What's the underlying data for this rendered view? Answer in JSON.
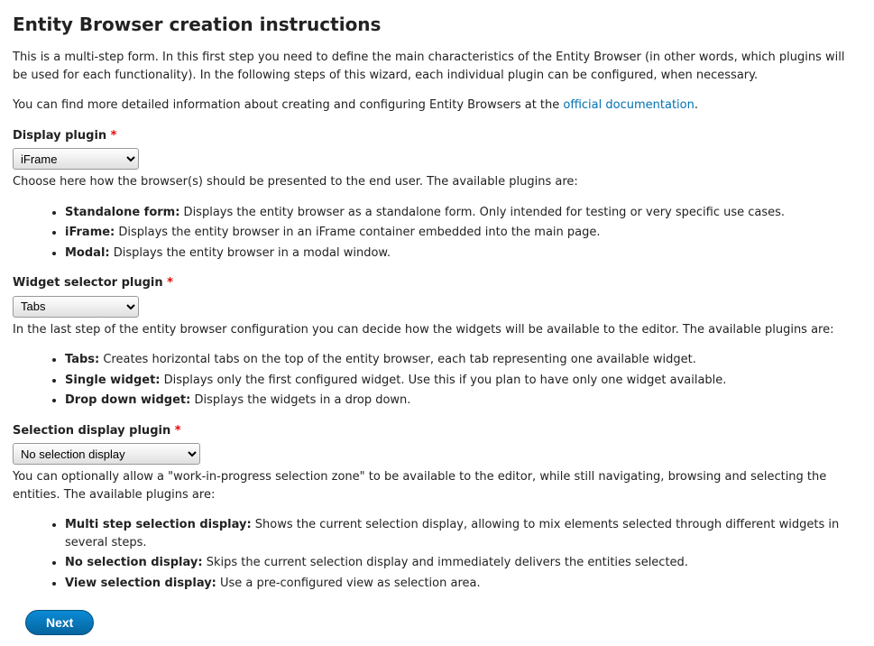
{
  "title": "Entity Browser creation instructions",
  "intro1": "This is a multi-step form. In this first step you need to define the main characteristics of the Entity Browser (in other words, which plugins will be used for each functionality). In the following steps of this wizard, each individual plugin can be configured, when necessary.",
  "intro2_pre": "You can find more detailed information about creating and configuring Entity Browsers at the ",
  "intro2_link": "official documentation",
  "intro2_post": ".",
  "fields": {
    "display": {
      "label": "Display plugin",
      "value": "iFrame",
      "desc": "Choose here how the browser(s) should be presented to the end user. The available plugins are:",
      "options": [
        {
          "name": "Standalone form:",
          "text": " Displays the entity browser as a standalone form. Only intended for testing or very specific use cases."
        },
        {
          "name": "iFrame:",
          "text": " Displays the entity browser in an iFrame container embedded into the main page."
        },
        {
          "name": "Modal:",
          "text": " Displays the entity browser in a modal window."
        }
      ]
    },
    "widget": {
      "label": "Widget selector plugin",
      "value": "Tabs",
      "desc": "In the last step of the entity browser configuration you can decide how the widgets will be available to the editor. The available plugins are:",
      "options": [
        {
          "name": "Tabs:",
          "text": " Creates horizontal tabs on the top of the entity browser, each tab representing one available widget."
        },
        {
          "name": "Single widget:",
          "text": " Displays only the first configured widget. Use this if you plan to have only one widget available."
        },
        {
          "name": "Drop down widget:",
          "text": " Displays the widgets in a drop down."
        }
      ]
    },
    "selection": {
      "label": "Selection display plugin",
      "value": "No selection display",
      "desc": "You can optionally allow a \"work-in-progress selection zone\" to be available to the editor, while still navigating, browsing and selecting the entities. The available plugins are:",
      "options": [
        {
          "name": "Multi step selection display:",
          "text": " Shows the current selection display, allowing to mix elements selected through different widgets in several steps."
        },
        {
          "name": "No selection display:",
          "text": " Skips the current selection display and immediately delivers the entities selected."
        },
        {
          "name": "View selection display:",
          "text": " Use a pre-configured view as selection area."
        }
      ]
    }
  },
  "next_label": "Next"
}
